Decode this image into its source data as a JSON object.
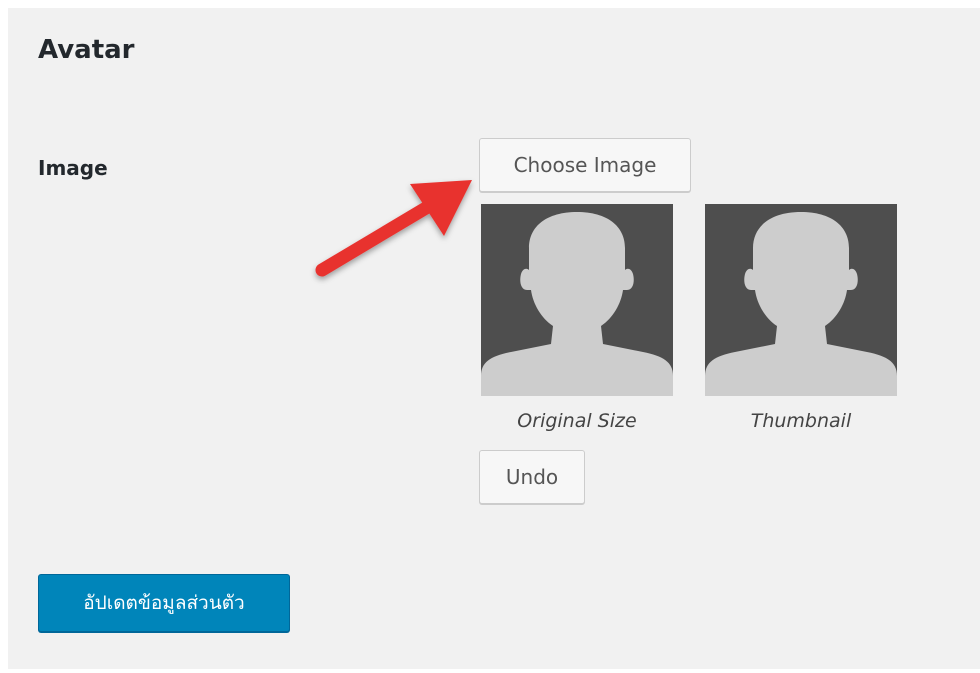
{
  "section": {
    "title": "Avatar"
  },
  "avatar_field": {
    "label": "Image",
    "choose_button": "Choose Image",
    "previews": [
      {
        "caption": "Original Size",
        "icon": "person-silhouette-icon"
      },
      {
        "caption": "Thumbnail",
        "icon": "person-silhouette-icon"
      }
    ],
    "undo_button": "Undo"
  },
  "form": {
    "submit_button": "อัปเดตข้อมูลส่วนตัว"
  },
  "colors": {
    "panel_background": "#f1f1f1",
    "avatar_background": "#4e4e4e",
    "silhouette": "#cdcdcd",
    "primary_button": "#0085ba",
    "annotation_arrow": "#e8312f"
  },
  "annotation": {
    "icon": "red-arrow-icon",
    "points_to": "choose-image-button"
  }
}
